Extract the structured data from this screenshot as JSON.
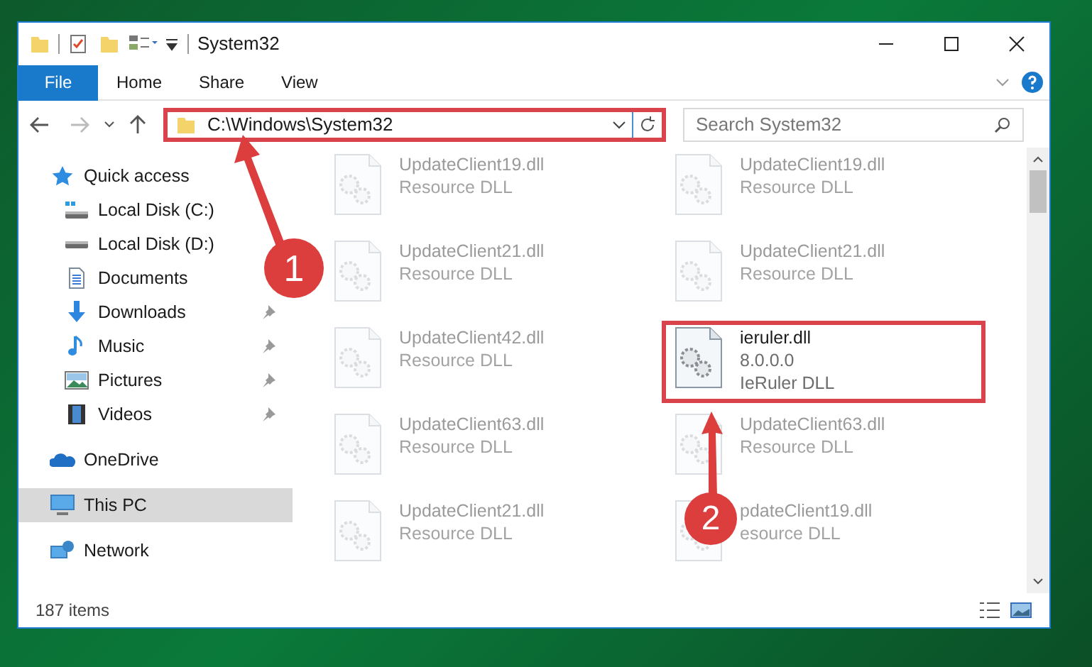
{
  "window": {
    "title": "System32"
  },
  "ribbon": {
    "tabs": [
      {
        "label": "File",
        "kind": "file",
        "selected": false
      },
      {
        "label": "Home",
        "kind": "tab",
        "selected": false
      },
      {
        "label": "Share",
        "kind": "tab",
        "selected": false
      },
      {
        "label": "View",
        "kind": "tab",
        "selected": false
      }
    ]
  },
  "address": {
    "path": "C:\\Windows\\System32",
    "highlighted": true
  },
  "search": {
    "placeholder": "Search System32"
  },
  "sidebar": {
    "items": [
      {
        "label": "Quick access",
        "kind": "star",
        "selected": false,
        "children": [
          {
            "label": "Local Disk (C:)",
            "kind": "disk-c",
            "pinned": false,
            "selected": false
          },
          {
            "label": "Local Disk (D:)",
            "kind": "disk",
            "pinned": false,
            "selected": false
          },
          {
            "label": "Documents",
            "kind": "documents",
            "pinned": false,
            "selected": false
          },
          {
            "label": "Downloads",
            "kind": "downloads",
            "pinned": true,
            "selected": false
          },
          {
            "label": "Music",
            "kind": "music",
            "pinned": true,
            "selected": false
          },
          {
            "label": "Pictures",
            "kind": "pictures",
            "pinned": true,
            "selected": false
          },
          {
            "label": "Videos",
            "kind": "videos",
            "pinned": true,
            "selected": false
          }
        ]
      },
      {
        "label": "OneDrive",
        "kind": "cloud",
        "selected": false
      },
      {
        "label": "This PC",
        "kind": "pc",
        "selected": true
      },
      {
        "label": "Network",
        "kind": "network",
        "selected": false
      }
    ]
  },
  "files": [
    {
      "name": "UpdateClient19.dll",
      "lines": [
        "Resource DLL"
      ],
      "faded": true,
      "highlighted": false
    },
    {
      "name": "UpdateClient19.dll",
      "lines": [
        "Resource DLL"
      ],
      "faded": true,
      "highlighted": false
    },
    {
      "name": "UpdateClient21.dll",
      "lines": [
        "Resource DLL"
      ],
      "faded": true,
      "highlighted": false
    },
    {
      "name": "UpdateClient21.dll",
      "lines": [
        "Resource DLL"
      ],
      "faded": true,
      "highlighted": false
    },
    {
      "name": "UpdateClient42.dll",
      "lines": [
        "Resource DLL"
      ],
      "faded": true,
      "highlighted": false
    },
    {
      "name": "ieruler.dll",
      "lines": [
        "8.0.0.0",
        "IeRuler DLL"
      ],
      "faded": false,
      "highlighted": true
    },
    {
      "name": "UpdateClient63.dll",
      "lines": [
        "Resource DLL"
      ],
      "faded": true,
      "highlighted": false
    },
    {
      "name": "UpdateClient63.dll",
      "lines": [
        "Resource DLL"
      ],
      "faded": true,
      "highlighted": false
    },
    {
      "name": "UpdateClient21.dll",
      "lines": [
        "Resource DLL"
      ],
      "faded": true,
      "highlighted": false
    },
    {
      "name": "pdateClient19.dll",
      "lines": [
        "esource DLL"
      ],
      "faded": true,
      "highlighted": false
    }
  ],
  "status_bar": {
    "count": "187 items"
  },
  "annotations": [
    {
      "number": "1"
    },
    {
      "number": "2"
    }
  ]
}
